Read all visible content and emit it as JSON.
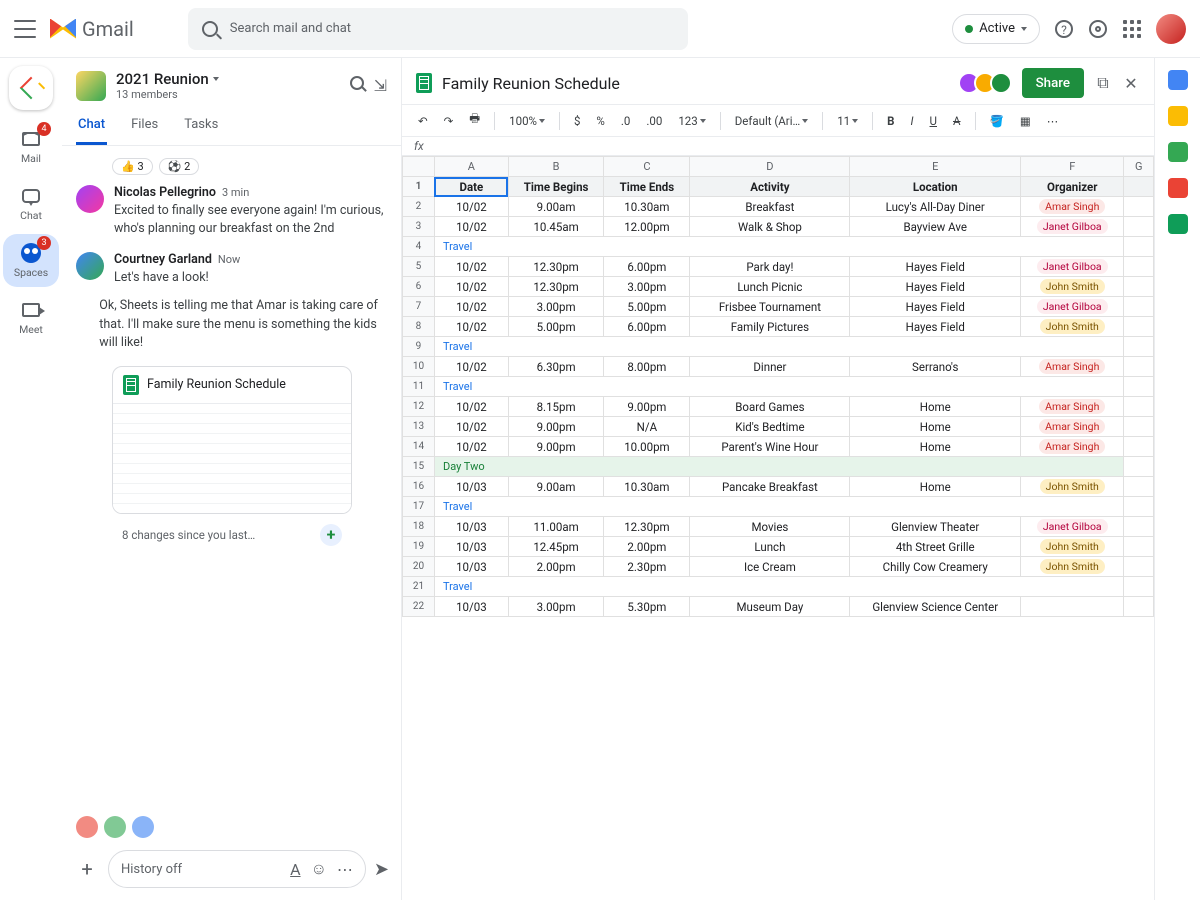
{
  "header": {
    "logo_text": "Gmail",
    "search_placeholder": "Search mail and chat",
    "status_label": "Active"
  },
  "rail": {
    "mail": "Mail",
    "mail_badge": "4",
    "chat": "Chat",
    "spaces": "Spaces",
    "spaces_badge": "3",
    "meet": "Meet"
  },
  "space": {
    "name": "2021 Reunion",
    "members": "13 members",
    "tabs": {
      "chat": "Chat",
      "files": "Files",
      "tasks": "Tasks"
    }
  },
  "reactions": [
    {
      "emoji": "👍",
      "count": "3"
    },
    {
      "emoji": "⚽",
      "count": "2"
    }
  ],
  "messages": [
    {
      "name": "Nicolas Pellegrino",
      "time": "3 min",
      "body": "Excited to finally see everyone again! I'm curious, who's planning our breakfast on the 2nd"
    },
    {
      "name": "Courtney Garland",
      "time": "Now",
      "body": "Let's have a look!"
    },
    {
      "name": "",
      "time": "",
      "body": "Ok, Sheets is telling me that Amar is taking care of that. I'll make sure the menu is something the kids will like!"
    }
  ],
  "sheet_card": {
    "title": "Family Reunion Schedule",
    "footer": "8 changes since you last…"
  },
  "composer": {
    "history": "History off"
  },
  "sheet": {
    "title": "Family Reunion Schedule",
    "share": "Share",
    "toolbar": {
      "zoom": "100%",
      "dollar": "$",
      "pct": "%",
      "dec": ".0",
      "inc": ".00",
      "num": "123",
      "font": "Default (Ari…",
      "size": "11"
    },
    "fx": "fx",
    "cols": [
      "A",
      "B",
      "C",
      "D",
      "E",
      "F",
      "G"
    ],
    "headers": {
      "A": "Date",
      "B": "Time Begins",
      "C": "Time Ends",
      "D": "Activity",
      "E": "Location",
      "F": "Organizer"
    }
  },
  "chart_data": {
    "type": "table",
    "columns": [
      "row",
      "Date",
      "Time Begins",
      "Time Ends",
      "Activity",
      "Location",
      "Organizer"
    ],
    "rows": [
      [
        "2",
        "10/02",
        "9.00am",
        "10.30am",
        "Breakfast",
        "Lucy's All-Day Diner",
        "Amar Singh"
      ],
      [
        "3",
        "10/02",
        "10.45am",
        "12.00pm",
        "Walk & Shop",
        "Bayview Ave",
        "Janet Gilboa"
      ],
      [
        "4",
        "Travel",
        "",
        "",
        "",
        "",
        ""
      ],
      [
        "5",
        "10/02",
        "12.30pm",
        "6.00pm",
        "Park day!",
        "Hayes Field",
        "Janet Gilboa"
      ],
      [
        "6",
        "10/02",
        "12.30pm",
        "3.00pm",
        "Lunch Picnic",
        "Hayes Field",
        "John Smith"
      ],
      [
        "7",
        "10/02",
        "3.00pm",
        "5.00pm",
        "Frisbee Tournament",
        "Hayes Field",
        "Janet Gilboa"
      ],
      [
        "8",
        "10/02",
        "5.00pm",
        "6.00pm",
        "Family Pictures",
        "Hayes Field",
        "John Smith"
      ],
      [
        "9",
        "Travel",
        "",
        "",
        "",
        "",
        ""
      ],
      [
        "10",
        "10/02",
        "6.30pm",
        "8.00pm",
        "Dinner",
        "Serrano's",
        "Amar Singh"
      ],
      [
        "11",
        "Travel",
        "",
        "",
        "",
        "",
        ""
      ],
      [
        "12",
        "10/02",
        "8.15pm",
        "9.00pm",
        "Board Games",
        "Home",
        "Amar Singh"
      ],
      [
        "13",
        "10/02",
        "9.00pm",
        "N/A",
        "Kid's Bedtime",
        "Home",
        "Amar Singh"
      ],
      [
        "14",
        "10/02",
        "9.00pm",
        "10.00pm",
        "Parent's Wine Hour",
        "Home",
        "Amar Singh"
      ],
      [
        "15",
        "Day Two",
        "",
        "",
        "",
        "",
        ""
      ],
      [
        "16",
        "10/03",
        "9.00am",
        "10.30am",
        "Pancake Breakfast",
        "Home",
        "John Smith"
      ],
      [
        "17",
        "Travel",
        "",
        "",
        "",
        "",
        ""
      ],
      [
        "18",
        "10/03",
        "11.00am",
        "12.30pm",
        "Movies",
        "Glenview Theater",
        "Janet Gilboa"
      ],
      [
        "19",
        "10/03",
        "12.45pm",
        "2.00pm",
        "Lunch",
        "4th Street Grille",
        "John Smith"
      ],
      [
        "20",
        "10/03",
        "2.00pm",
        "2.30pm",
        "Ice Cream",
        "Chilly Cow Creamery",
        "John Smith"
      ],
      [
        "21",
        "Travel",
        "",
        "",
        "",
        "",
        ""
      ],
      [
        "22",
        "10/03",
        "3.00pm",
        "5.30pm",
        "Museum Day",
        "Glenview Science Center",
        ""
      ]
    ]
  }
}
